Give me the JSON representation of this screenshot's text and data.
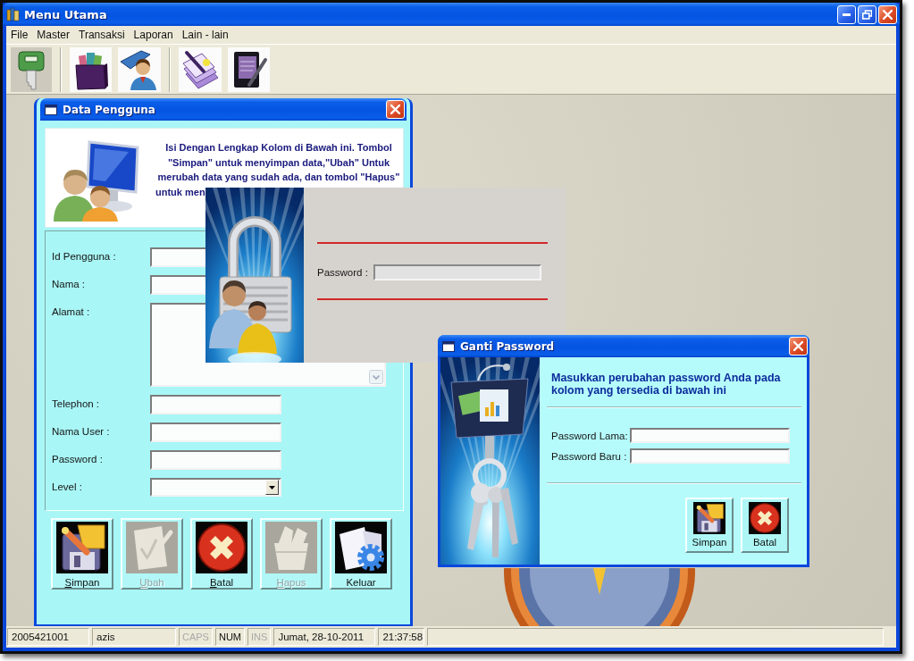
{
  "window": {
    "title": "Menu Utama"
  },
  "menu": [
    "File",
    "Master",
    "Transaksi",
    "Laporan",
    "Lain - lain"
  ],
  "toolbar": [
    {
      "buttons": [
        {
          "kind": "key"
        }
      ]
    },
    {
      "buttons": [
        {
          "kind": "archive"
        },
        {
          "kind": "person-folder"
        }
      ]
    },
    {
      "buttons": [
        {
          "kind": "document-pen"
        },
        {
          "kind": "notebook"
        }
      ]
    }
  ],
  "data_pengguna": {
    "title": "Data Pengguna",
    "instruction": "Isi Dengan Lengkap Kolom di Bawah ini. Tombol \"Simpan\" untuk menyimpan data,\"Ubah\" Untuk merubah data yang sudah ada, dan tombol \"Hapus\" untuk men",
    "fields": [
      {
        "label": "Id Pengguna :",
        "kind": "text"
      },
      {
        "label": "Nama :",
        "kind": "text"
      },
      {
        "label": "Alamat :",
        "kind": "textarea"
      },
      {
        "label": "Telephon :",
        "kind": "text"
      },
      {
        "label": "Nama User :",
        "kind": "text"
      },
      {
        "label": "Password :",
        "kind": "text"
      },
      {
        "label": "Level :",
        "kind": "dropdown"
      }
    ],
    "buttons": [
      {
        "kind": "save",
        "label": "Simpan",
        "mnemonic": true,
        "disabled": false
      },
      {
        "kind": "edit",
        "label": "Ubah",
        "mnemonic": true,
        "disabled": true
      },
      {
        "kind": "cancel",
        "label": "Batal",
        "mnemonic": true,
        "disabled": false
      },
      {
        "kind": "delete",
        "label": "Hapus",
        "mnemonic": true,
        "disabled": true
      },
      {
        "kind": "exit",
        "label": "Keluar",
        "mnemonic": false,
        "disabled": false
      }
    ]
  },
  "login_panel": {
    "fields": [
      {
        "label": "Password :"
      }
    ]
  },
  "ganti_password": {
    "title": "Ganti Password",
    "instruction": "Masukkan perubahan password Anda pada kolom yang tersedia di bawah ini",
    "fields": [
      {
        "label": "Password Lama:"
      },
      {
        "label": "Password Baru :"
      }
    ],
    "buttons": [
      {
        "kind": "save",
        "label": "Simpan"
      },
      {
        "kind": "cancel",
        "label": "Batal"
      }
    ]
  },
  "status_bar": {
    "panels": [
      {
        "kind": "text",
        "text": "2005421001"
      },
      {
        "kind": "text",
        "text": "azis"
      },
      {
        "kind": "key",
        "text": "CAPS",
        "on": false
      },
      {
        "kind": "key",
        "text": "NUM",
        "on": true
      },
      {
        "kind": "key",
        "text": "INS",
        "on": false
      },
      {
        "kind": "text",
        "text": "Jumat, 28-10-2011"
      },
      {
        "kind": "text",
        "text": "21:37:58"
      },
      {
        "kind": "spacer"
      }
    ]
  }
}
